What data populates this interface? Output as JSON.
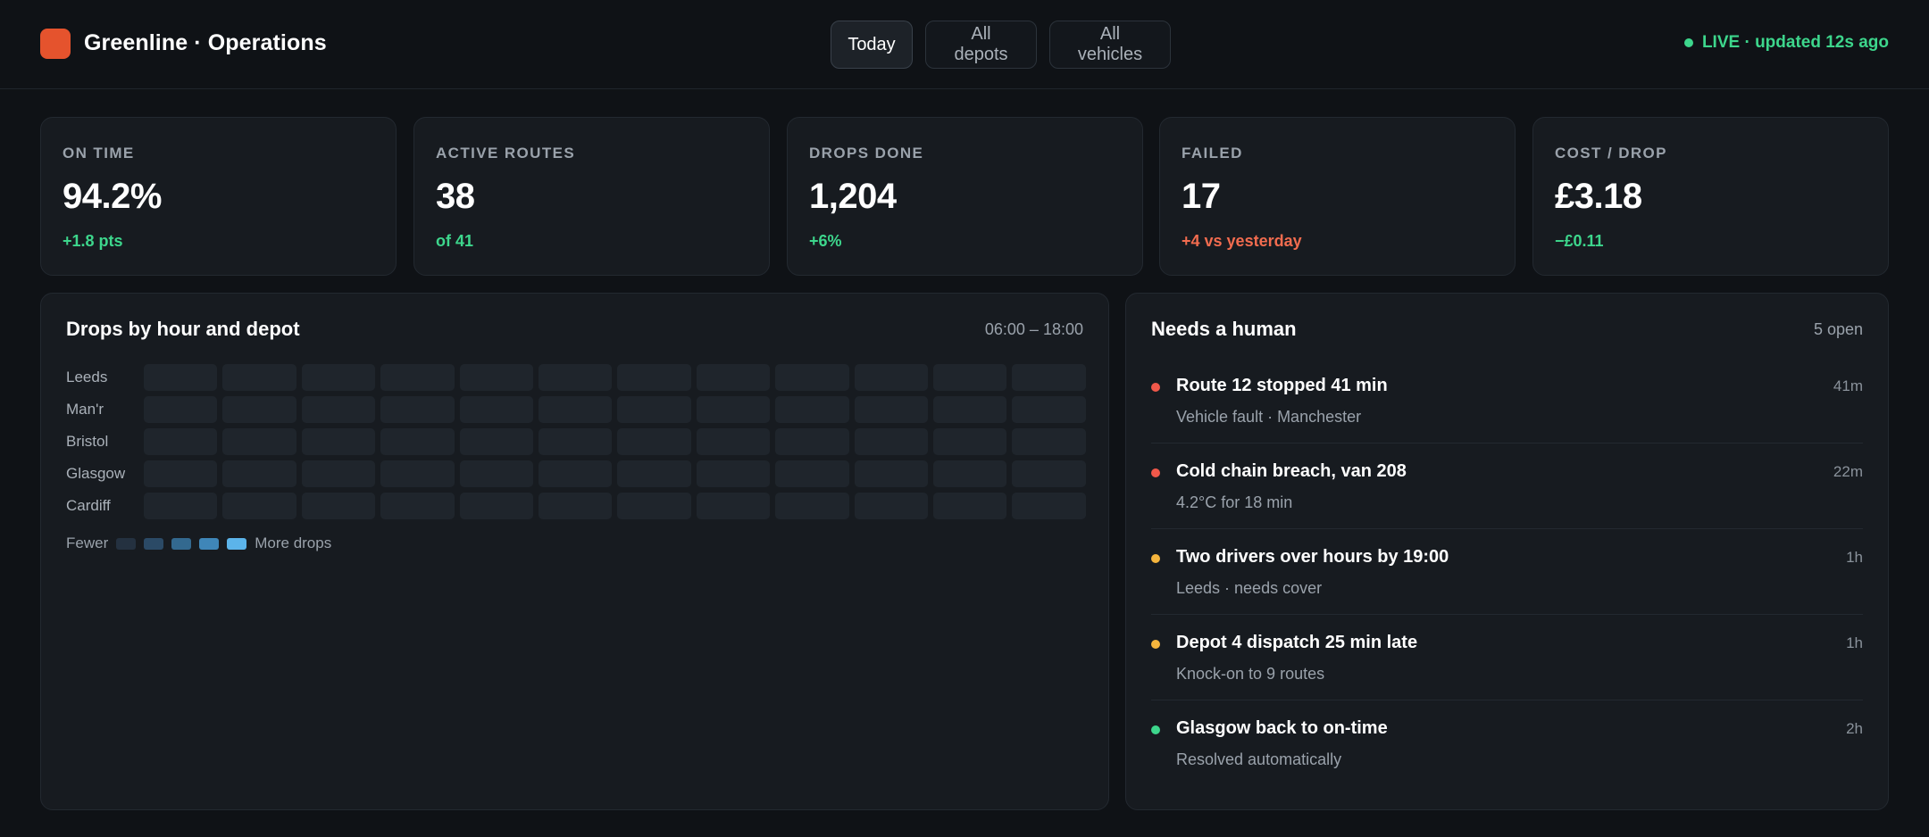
{
  "app": {
    "title": "Greenline · Operations",
    "brand_color": "#e5532d"
  },
  "filters": [
    {
      "label": "Today",
      "active": true
    },
    {
      "label": "All depots",
      "active": false
    },
    {
      "label": "All vehicles",
      "active": false
    }
  ],
  "status": {
    "text": "LIVE · updated 12s ago",
    "color": "#3dd68c"
  },
  "kpis": [
    {
      "label": "ON TIME",
      "value": "94.2%",
      "delta": "+1.8 pts",
      "tone": "good"
    },
    {
      "label": "ACTIVE ROUTES",
      "value": "38",
      "delta": "of 41",
      "tone": "good"
    },
    {
      "label": "DROPS DONE",
      "value": "1,204",
      "delta": "+6%",
      "tone": "good"
    },
    {
      "label": "FAILED",
      "value": "17",
      "delta": "+4 vs yesterday",
      "tone": "bad"
    },
    {
      "label": "COST / DROP",
      "value": "£3.18",
      "delta": "−£0.11",
      "tone": "good"
    }
  ],
  "heatmap": {
    "title": "Drops by hour and depot",
    "range": "06:00 – 18:00",
    "depots": [
      "Leeds",
      "Man'r",
      "Bristol",
      "Glasgow",
      "Cardiff"
    ],
    "columns": 12,
    "legend": {
      "low_label": "Fewer",
      "high_label": "More drops",
      "colors": [
        "#243140",
        "#2b4a66",
        "#33698f",
        "#3f86b8",
        "#5cb4ea"
      ]
    }
  },
  "needs": {
    "title": "Needs a human",
    "count": "5 open",
    "issues": [
      {
        "title": "Route 12 stopped 41 min",
        "sub": "Vehicle fault · Manchester",
        "age": "41m",
        "color": "#f0584a"
      },
      {
        "title": "Cold chain breach, van 208",
        "sub": "4.2°C for 18 min",
        "age": "22m",
        "color": "#f0584a"
      },
      {
        "title": "Two drivers over hours by 19:00",
        "sub": "Leeds · needs cover",
        "age": "1h",
        "color": "#f5b53d"
      },
      {
        "title": "Depot 4 dispatch 25 min late",
        "sub": "Knock-on to 9 routes",
        "age": "1h",
        "color": "#f5b53d"
      },
      {
        "title": "Glasgow back to on-time",
        "sub": "Resolved automatically",
        "age": "2h",
        "color": "#3dd68c"
      }
    ]
  }
}
